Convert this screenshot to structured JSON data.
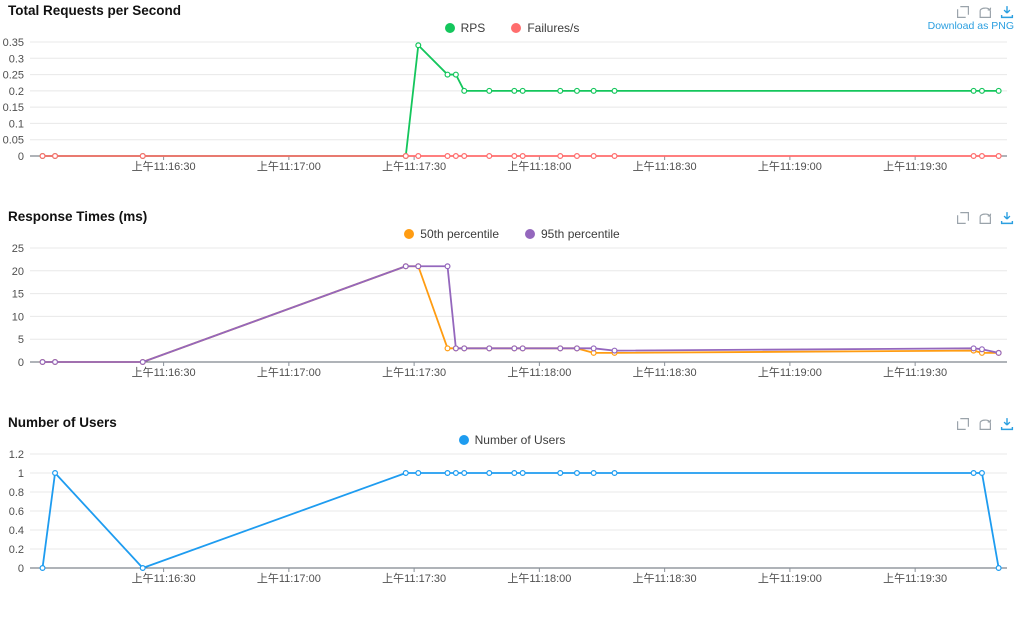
{
  "page": {
    "background": "#ffffff",
    "download_link": "Download as PNG",
    "toolbox_icons": [
      "box-zoom-icon",
      "restore-icon",
      "save-as-image-icon"
    ],
    "colors": {
      "link_blue": "#2b9fe0",
      "icon_gray": "#9aa3aa",
      "grid": "#e8e8e8",
      "axis": "#5f6772",
      "tick_text": "#4f4f4f"
    }
  },
  "chart_data": [
    {
      "type": "line",
      "title": "Total Requests per Second",
      "legend_position": "top-center",
      "grid": true,
      "x_tick_labels": [
        "上午11:16:30",
        "上午11:17:00",
        "上午11:17:30",
        "上午11:18:00",
        "上午11:18:30",
        "上午11:19:00",
        "上午11:19:30"
      ],
      "x_tick_seconds": [
        32,
        62,
        92,
        122,
        152,
        182,
        212
      ],
      "x_domain_seconds": [
        0,
        234
      ],
      "sample_times": [
        "11:16:01",
        "11:16:04",
        "11:16:25",
        "11:17:28",
        "11:17:31",
        "11:17:38",
        "11:17:40",
        "11:17:42",
        "11:17:48",
        "11:17:54",
        "11:17:56",
        "11:18:05",
        "11:18:09",
        "11:18:13",
        "11:18:18",
        "11:19:44",
        "11:19:46",
        "11:19:50"
      ],
      "x_seconds": [
        3,
        6,
        27,
        90,
        93,
        100,
        102,
        104,
        110,
        116,
        118,
        127,
        131,
        135,
        140,
        226,
        228,
        232
      ],
      "ylim": [
        0,
        0.35
      ],
      "y_ticks": [
        0,
        0.05,
        0.1,
        0.15,
        0.2,
        0.25,
        0.3,
        0.35
      ],
      "series": [
        {
          "name": "RPS",
          "color": "#14c65c",
          "values": [
            0,
            0,
            0,
            0,
            0.34,
            0.25,
            0.25,
            0.2,
            0.2,
            0.2,
            0.2,
            0.2,
            0.2,
            0.2,
            0.2,
            0.2,
            0.2,
            0.2
          ]
        },
        {
          "name": "Failures/s",
          "color": "#ff6d6d",
          "values": [
            0,
            0,
            0,
            0,
            0,
            0,
            0,
            0,
            0,
            0,
            0,
            0,
            0,
            0,
            0,
            0,
            0,
            0
          ]
        }
      ]
    },
    {
      "type": "line",
      "title": "Response Times (ms)",
      "legend_position": "top-center",
      "grid": true,
      "x_tick_labels": [
        "上午11:16:30",
        "上午11:17:00",
        "上午11:17:30",
        "上午11:18:00",
        "上午11:18:30",
        "上午11:19:00",
        "上午11:19:30"
      ],
      "x_tick_seconds": [
        32,
        62,
        92,
        122,
        152,
        182,
        212
      ],
      "x_domain_seconds": [
        0,
        234
      ],
      "sample_times": [
        "11:16:01",
        "11:16:04",
        "11:16:25",
        "11:17:28",
        "11:17:31",
        "11:17:38",
        "11:17:40",
        "11:17:42",
        "11:17:48",
        "11:17:54",
        "11:17:56",
        "11:18:05",
        "11:18:09",
        "11:18:13",
        "11:18:18",
        "11:19:44",
        "11:19:46",
        "11:19:50"
      ],
      "x_seconds": [
        3,
        6,
        27,
        90,
        93,
        100,
        102,
        104,
        110,
        116,
        118,
        127,
        131,
        135,
        140,
        226,
        228,
        232
      ],
      "ylim": [
        0,
        25
      ],
      "y_ticks": [
        0,
        5,
        10,
        15,
        20,
        25
      ],
      "series": [
        {
          "name": "50th percentile",
          "color": "#ff9c12",
          "values": [
            0,
            0,
            0,
            21,
            21,
            3,
            3,
            3,
            3,
            3,
            3,
            3,
            3,
            2,
            2,
            2.5,
            2,
            2
          ]
        },
        {
          "name": "95th percentile",
          "color": "#9467bd",
          "values": [
            0,
            0,
            0,
            21,
            21,
            21,
            3,
            3,
            3,
            3,
            3,
            3,
            3,
            3,
            2.5,
            3,
            2.8,
            2
          ]
        }
      ]
    },
    {
      "type": "line",
      "title": "Number of Users",
      "legend_position": "top-center",
      "grid": true,
      "x_tick_labels": [
        "上午11:16:30",
        "上午11:17:00",
        "上午11:17:30",
        "上午11:18:00",
        "上午11:18:30",
        "上午11:19:00",
        "上午11:19:30"
      ],
      "x_tick_seconds": [
        32,
        62,
        92,
        122,
        152,
        182,
        212
      ],
      "x_domain_seconds": [
        0,
        234
      ],
      "sample_times": [
        "11:16:01",
        "11:16:04",
        "11:16:25",
        "11:17:28",
        "11:17:31",
        "11:17:38",
        "11:17:40",
        "11:17:42",
        "11:17:48",
        "11:17:54",
        "11:17:56",
        "11:18:05",
        "11:18:09",
        "11:18:13",
        "11:18:18",
        "11:19:44",
        "11:19:46",
        "11:19:50"
      ],
      "x_seconds": [
        3,
        6,
        27,
        90,
        93,
        100,
        102,
        104,
        110,
        116,
        118,
        127,
        131,
        135,
        140,
        226,
        228,
        232
      ],
      "ylim": [
        0,
        1.2
      ],
      "y_ticks": [
        0,
        0.2,
        0.4,
        0.6,
        0.8,
        1,
        1.2
      ],
      "series": [
        {
          "name": "Number of Users",
          "color": "#1e9cf0",
          "values": [
            0,
            1,
            0,
            1,
            1,
            1,
            1,
            1,
            1,
            1,
            1,
            1,
            1,
            1,
            1,
            1,
            1,
            0
          ]
        }
      ]
    }
  ]
}
